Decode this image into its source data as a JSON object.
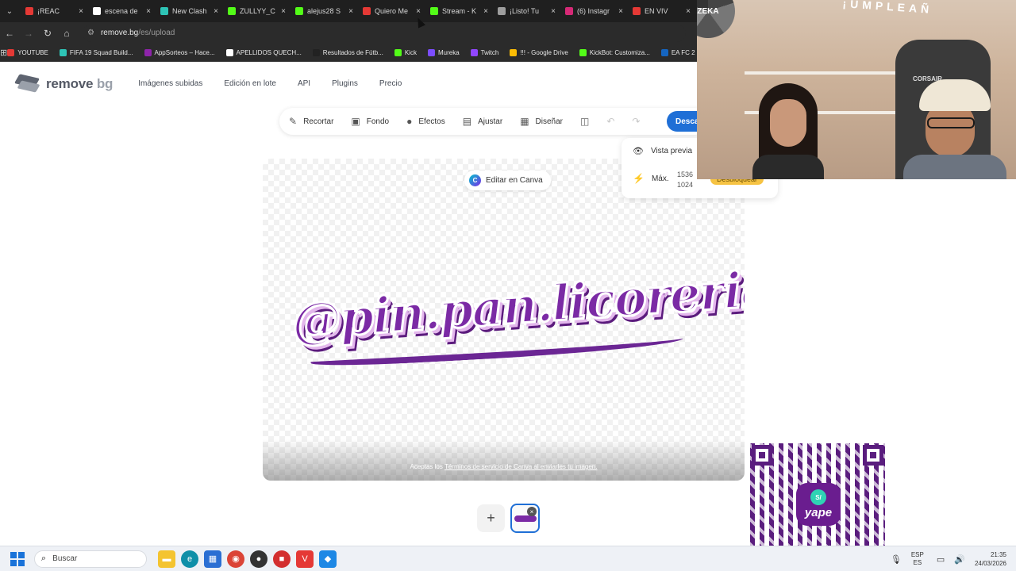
{
  "browser": {
    "tabs": [
      {
        "title": "¡REAC",
        "color": "#e53935"
      },
      {
        "title": "escena de",
        "color": "#ffffff"
      },
      {
        "title": "New Clash",
        "color": "#2ec4b6"
      },
      {
        "title": "ZULLYY_C",
        "color": "#53fc18"
      },
      {
        "title": "alejus28 S",
        "color": "#53fc18"
      },
      {
        "title": "Quiero Me",
        "color": "#e53935"
      },
      {
        "title": "Stream - K",
        "color": "#53fc18"
      },
      {
        "title": "¡Listo! Tu",
        "color": "#9e9e9e"
      },
      {
        "title": "(6) Instagr",
        "color": "#d62976"
      },
      {
        "title": "EN VIV",
        "color": "#e53935"
      }
    ],
    "url_host": "remove.bg",
    "url_path": "/es/upload",
    "bookmarks": [
      {
        "label": "YOUTUBE",
        "color": "#e53935"
      },
      {
        "label": "FIFA 19 Squad Build...",
        "color": "#2ec4b6"
      },
      {
        "label": "AppSorteos – Hace...",
        "color": "#8e24aa"
      },
      {
        "label": "APELLIDOS QUECH...",
        "color": "#ffffff"
      },
      {
        "label": "Resultados de Fútb...",
        "color": "#222222"
      },
      {
        "label": "Kick",
        "color": "#53fc18"
      },
      {
        "label": "Mureka",
        "color": "#7c4dff"
      },
      {
        "label": "Twitch",
        "color": "#9146ff"
      },
      {
        "label": "!!! - Google Drive",
        "color": "#fbbc04"
      },
      {
        "label": "KickBot: Customiza...",
        "color": "#53fc18"
      },
      {
        "label": "EA FC 2",
        "color": "#1565c0"
      }
    ]
  },
  "app": {
    "logo_main": "remove",
    "logo_accent": "bg",
    "nav": [
      "Imágenes subidas",
      "Edición en lote",
      "API",
      "Plugins",
      "Precio"
    ],
    "toolbar": {
      "recortar": "Recortar",
      "fondo": "Fondo",
      "efectos": "Efectos",
      "ajustar": "Ajustar",
      "disenar": "Diseñar",
      "download": "Desca"
    },
    "canvas": {
      "canva_button": "Editar en Canva",
      "terms_prefix": "Aceptas los ",
      "terms_link": "Términos de servicio de Canva al enviarles tu imagen.",
      "artwork_text": "@pin.pan.licoreria"
    },
    "preview": {
      "vista_previa": "Vista previa",
      "max_label": "Máx.",
      "max_width": "1536",
      "max_height": "1024",
      "unlock": "Desbloquear"
    }
  },
  "webcam": {
    "wheel_label": "ZEKA",
    "banner": "¡UMPLEAÑ",
    "chair_brand": "CORSAIR"
  },
  "qr": {
    "badge_symbol": "S/",
    "badge_text": "yape"
  },
  "taskbar": {
    "search_placeholder": "Buscar",
    "lang_top": "ESP",
    "lang_bottom": "ES",
    "time": "21:35",
    "date": "24/03/2026"
  }
}
